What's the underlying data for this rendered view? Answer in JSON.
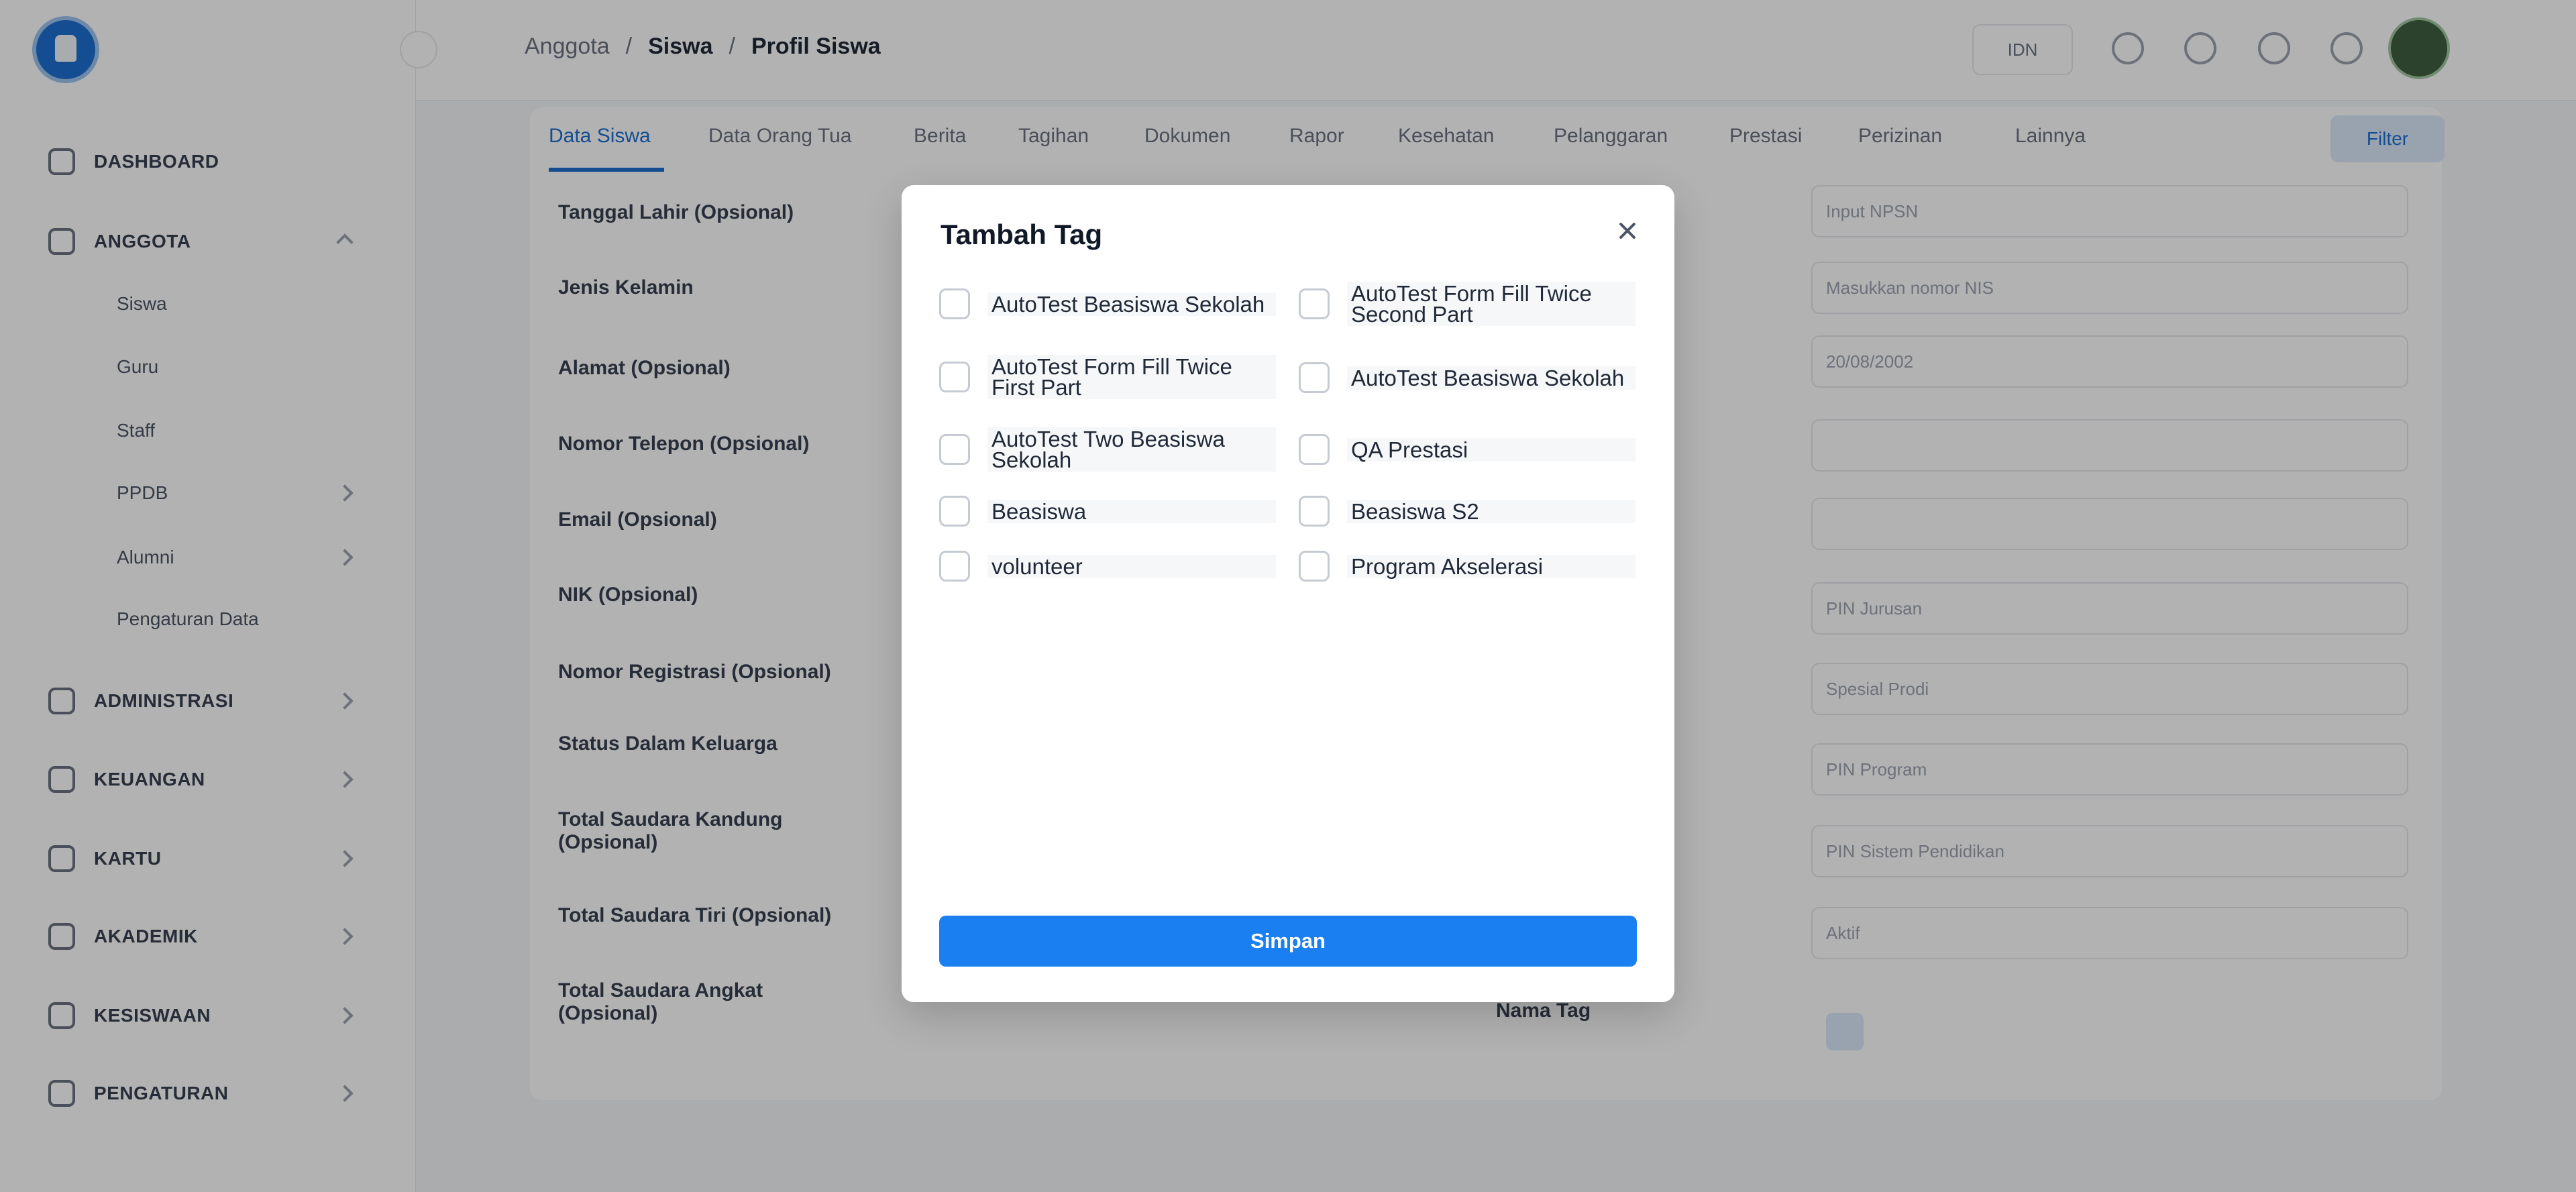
{
  "sidebar": {
    "items": [
      {
        "label": "DASHBOARD"
      },
      {
        "label": "ANGGOTA"
      },
      {
        "label": "ADMINISTRASI"
      },
      {
        "label": "KEUANGAN"
      },
      {
        "label": "KARTU"
      },
      {
        "label": "AKADEMIK"
      },
      {
        "label": "KESISWAAN"
      },
      {
        "label": "PENGATURAN"
      }
    ],
    "subitems": [
      {
        "label": "Siswa"
      },
      {
        "label": "Guru"
      },
      {
        "label": "Staff"
      },
      {
        "label": "PPDB"
      },
      {
        "label": "Alumni"
      },
      {
        "label": "Pengaturan Data"
      }
    ]
  },
  "breadcrumb": {
    "items": [
      "Anggota",
      "Siswa",
      "Profil Siswa"
    ],
    "separator": "/"
  },
  "topbar": {
    "language": "IDN"
  },
  "tabs": [
    {
      "label": "Data Siswa"
    },
    {
      "label": "Data Orang Tua"
    },
    {
      "label": "Berita"
    },
    {
      "label": "Tagihan"
    },
    {
      "label": "Dokumen"
    },
    {
      "label": "Rapor"
    },
    {
      "label": "Kesehatan"
    },
    {
      "label": "Pelanggaran"
    },
    {
      "label": "Prestasi"
    },
    {
      "label": "Perizinan"
    },
    {
      "label": "Lainnya"
    }
  ],
  "filter_label": "Filter",
  "form": {
    "left_labels": [
      "Tanggal Lahir (Opsional)",
      "Jenis Kelamin",
      "Alamat (Opsional)",
      "Nomor Telepon (Opsional)",
      "Email (Opsional)",
      "NIK (Opsional)",
      "Nomor Registrasi (Opsional)",
      "Status Dalam Keluarga",
      "Total Saudara Kandung (Opsional)",
      "Total Saudara Tiri (Opsional)",
      "Total Saudara Angkat (Opsional)"
    ],
    "right_placeholders": [
      "Input NPSN",
      "Masukkan nomor NIS",
      "20/08/2002",
      "",
      "",
      "PIN Jurusan",
      "Spesial Prodi",
      "PIN Program",
      "PIN Sistem Pendidikan",
      "Aktif"
    ],
    "tag_label": "Nama Tag"
  },
  "modal": {
    "title": "Tambah Tag",
    "options": [
      {
        "label": "AutoTest Beasiswa Sekolah",
        "checked": false
      },
      {
        "label": "AutoTest Form Fill Twice Second Part",
        "checked": false
      },
      {
        "label": "AutoTest Form Fill Twice First Part",
        "checked": false
      },
      {
        "label": "AutoTest Beasiswa Sekolah",
        "checked": false
      },
      {
        "label": "AutoTest Two Beasiswa Sekolah",
        "checked": false
      },
      {
        "label": "QA Prestasi",
        "checked": false
      },
      {
        "label": "Beasiswa",
        "checked": false
      },
      {
        "label": "Beasiswa S2",
        "checked": false
      },
      {
        "label": "volunteer",
        "checked": false
      },
      {
        "label": "Program Akselerasi",
        "checked": false
      }
    ],
    "submit_label": "Simpan"
  },
  "colors": {
    "primary": "#1a7ff0",
    "overlay": "rgba(0,0,0,0.30)",
    "modal_bg": "#ffffff"
  }
}
